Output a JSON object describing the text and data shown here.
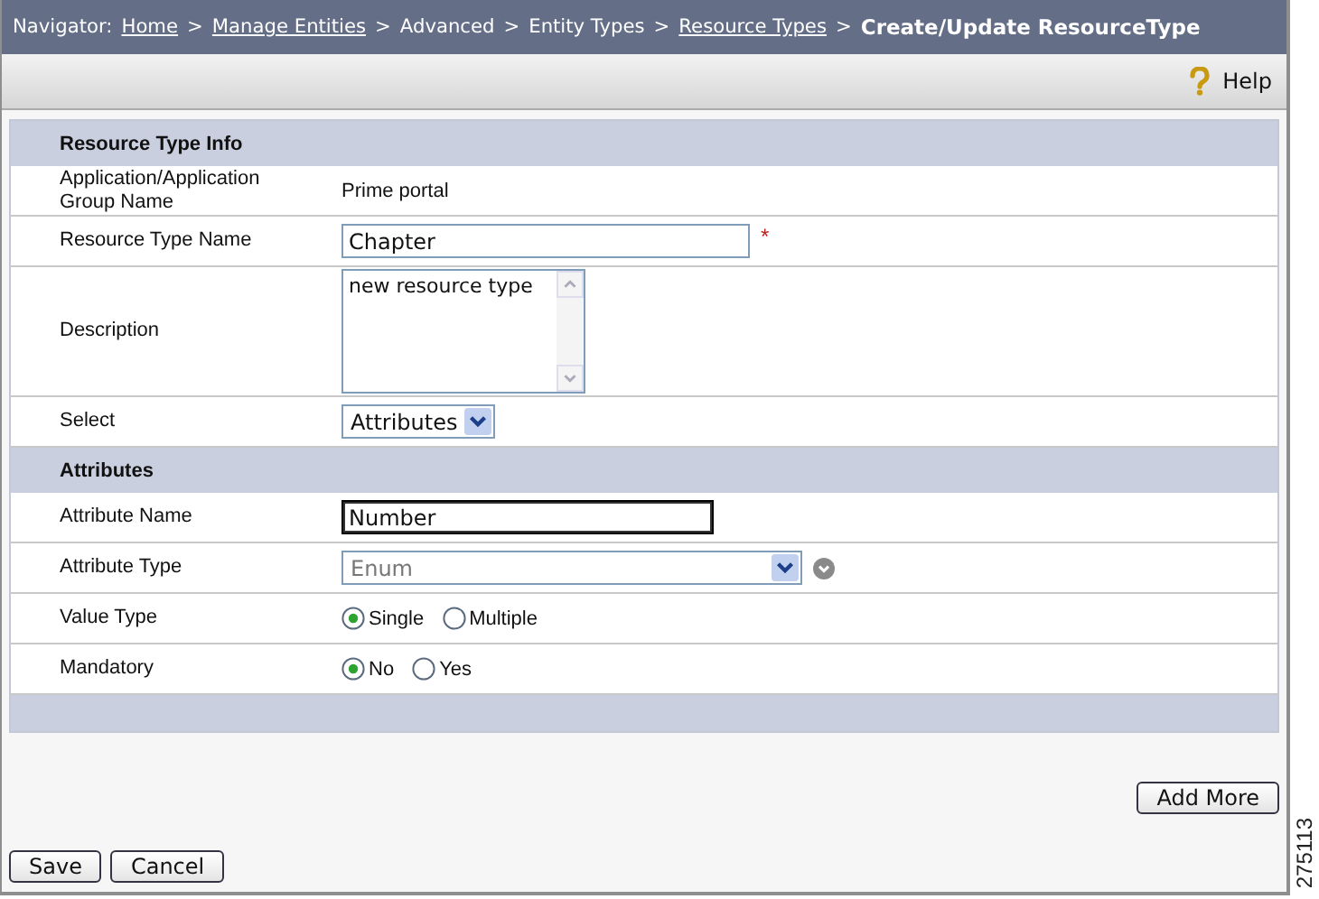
{
  "breadcrumb": {
    "prefix": "Navigator:",
    "items": [
      {
        "label": "Home",
        "kind": "link"
      },
      {
        "label": "Manage Entities",
        "kind": "link",
        "sep": ">"
      },
      {
        "label": "Advanced",
        "kind": "text",
        "sep": ">"
      },
      {
        "label": "Entity Types",
        "kind": "text",
        "sep": ">"
      },
      {
        "label": "Resource Types",
        "kind": "link",
        "sep": ">"
      },
      {
        "label": "Create/Update ResourceType",
        "kind": "current",
        "sep": ">"
      }
    ]
  },
  "toolbar": {
    "help": "Help"
  },
  "sections": [
    {
      "title": "Resource Type Info",
      "rows": [
        {
          "label": "Application/Application Group Name",
          "kind": "text",
          "value": "Prime portal"
        },
        {
          "label": "Resource Type Name",
          "kind": "input",
          "value": "Chapter",
          "required": true,
          "required_mark": "*"
        },
        {
          "label": "Description",
          "kind": "textarea",
          "value": "new resource type"
        },
        {
          "label": "Select",
          "kind": "select",
          "value": "Attributes"
        }
      ]
    },
    {
      "title": "Attributes",
      "rows": [
        {
          "label": "Attribute Name",
          "kind": "input",
          "value": "Number",
          "focused": true
        },
        {
          "label": "Attribute Type",
          "kind": "combo",
          "value": "Enum",
          "disabled": true
        },
        {
          "label": "Value Type",
          "kind": "radio",
          "options": [
            {
              "label": "Single",
              "selected": true
            },
            {
              "label": "Multiple",
              "selected": false
            }
          ]
        },
        {
          "label": "Mandatory",
          "kind": "radio",
          "options": [
            {
              "label": "No",
              "selected": true
            },
            {
              "label": "Yes",
              "selected": false
            }
          ]
        }
      ]
    }
  ],
  "add_more": "Add More",
  "buttons": [
    "Save",
    "Cancel"
  ],
  "figure_number": "275113"
}
